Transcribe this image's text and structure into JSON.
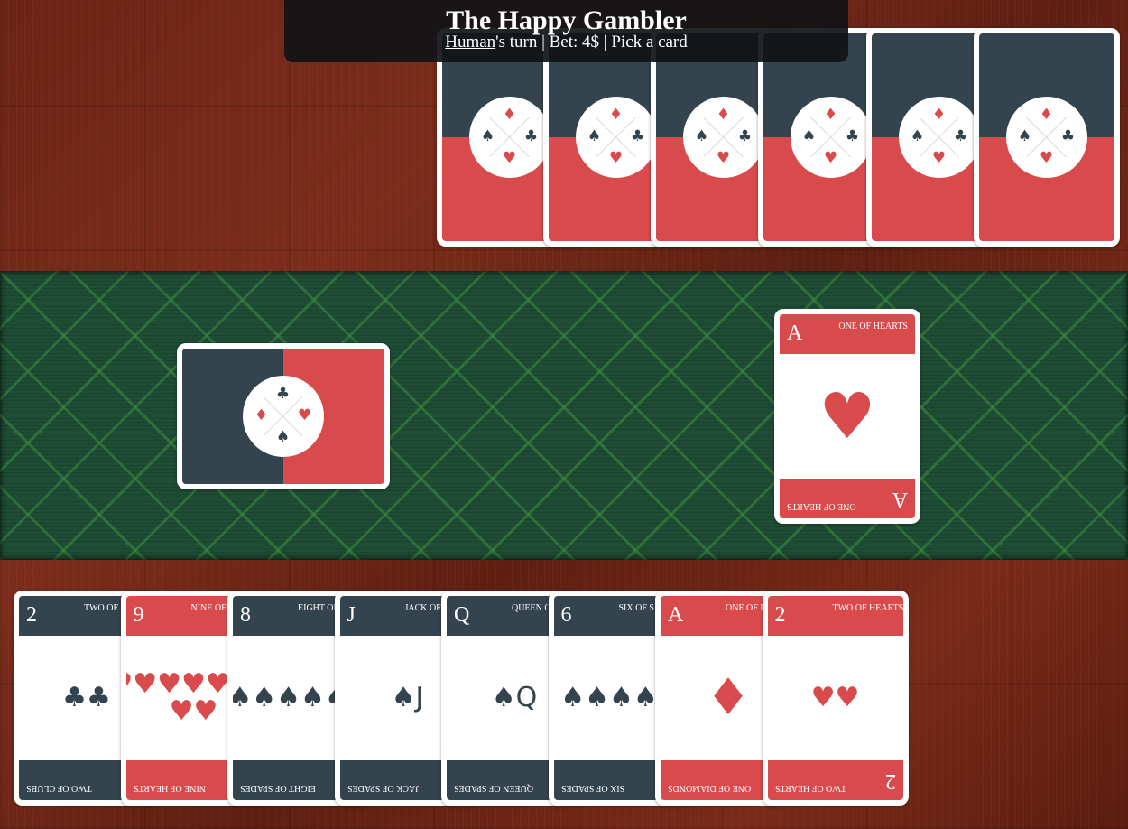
{
  "header": {
    "title": "The Happy Gambler",
    "player": "Human",
    "status_rest": "'s turn | Bet: 4$ | Pick a card"
  },
  "opponent_hand": {
    "count": 6,
    "back_pips": {
      "top": "♦",
      "left": "♠",
      "right": "♣",
      "bottom": "♥"
    }
  },
  "deck": {
    "back_pips": {
      "top": "♣",
      "left": "♦",
      "right": "♥",
      "bottom": "♠"
    }
  },
  "discard": {
    "rank": "A",
    "name": "ONE OF HEARTS",
    "suit": "♥",
    "color": "red"
  },
  "player_hand": [
    {
      "rank": "2",
      "name": "TWO OF CLUBS",
      "short_name": "TWO OF",
      "suit": "♣",
      "color": "dark",
      "pips": "♣♣"
    },
    {
      "rank": "9",
      "name": "NINE OF HEARTS",
      "short_name": "NINE OF H",
      "suit": "♥",
      "color": "red",
      "pips": "♥♥♥♥♥♥♥ ♥♥"
    },
    {
      "rank": "8",
      "name": "EIGHT OF SPADES",
      "short_name": "EIGHT OF S",
      "suit": "♠",
      "color": "dark",
      "pips": "♠♠♠♠♠♠"
    },
    {
      "rank": "J",
      "name": "JACK OF SPADES",
      "short_name": "JACK OF S",
      "suit": "♠",
      "color": "dark",
      "pips": "♠J"
    },
    {
      "rank": "Q",
      "name": "QUEEN OF SPADES",
      "short_name": "QUEEN OF S",
      "suit": "♠",
      "color": "dark",
      "pips": "♠Q"
    },
    {
      "rank": "6",
      "name": "SIX OF SPADES",
      "short_name": "SIX OF S",
      "suit": "♠",
      "color": "dark",
      "pips": "♠♠♠♠♠"
    },
    {
      "rank": "A",
      "name": "ONE OF DIAMONDS",
      "short_name": "ONE OF DIAM",
      "suit": "♦",
      "color": "red",
      "pips": "♦"
    },
    {
      "rank": "2",
      "name": "TWO OF HEARTS",
      "short_name": "TWO OF HEARTS",
      "suit": "♥",
      "color": "red",
      "pips": "♥♥"
    }
  ],
  "colors": {
    "red": "#d84a4b",
    "dark": "#34444e",
    "felt": "#1f4c35",
    "wood": "#6b2416"
  }
}
